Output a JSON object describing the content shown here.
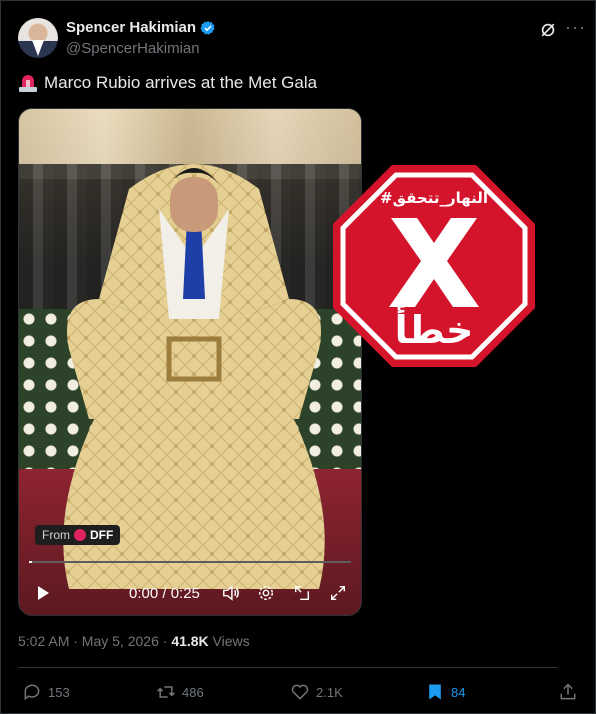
{
  "user": {
    "name": "Spencer Hakimian",
    "handle": "@SpencerHakimian"
  },
  "tweet": {
    "text": "Marco Rubio arrives at the Met Gala"
  },
  "media": {
    "source_prefix": "From",
    "source_name": "DFF",
    "time_display": "0:00 / 0:25",
    "progress_fraction": 0.01
  },
  "overlay": {
    "hashtag": "#النهار_تتحقق",
    "verdict": "خطأ",
    "color": "#d3142b"
  },
  "meta": {
    "timestamp": "5:02 AM · May 5, 2026",
    "separator": " · ",
    "views_count": "41.8K",
    "views_label": " Views"
  },
  "actions": {
    "replies": "153",
    "reposts": "486",
    "likes": "2.1K",
    "bookmarks": "84"
  },
  "colors": {
    "accent": "#1d9bf0",
    "muted": "#71767b",
    "text": "#e7e9ea"
  }
}
